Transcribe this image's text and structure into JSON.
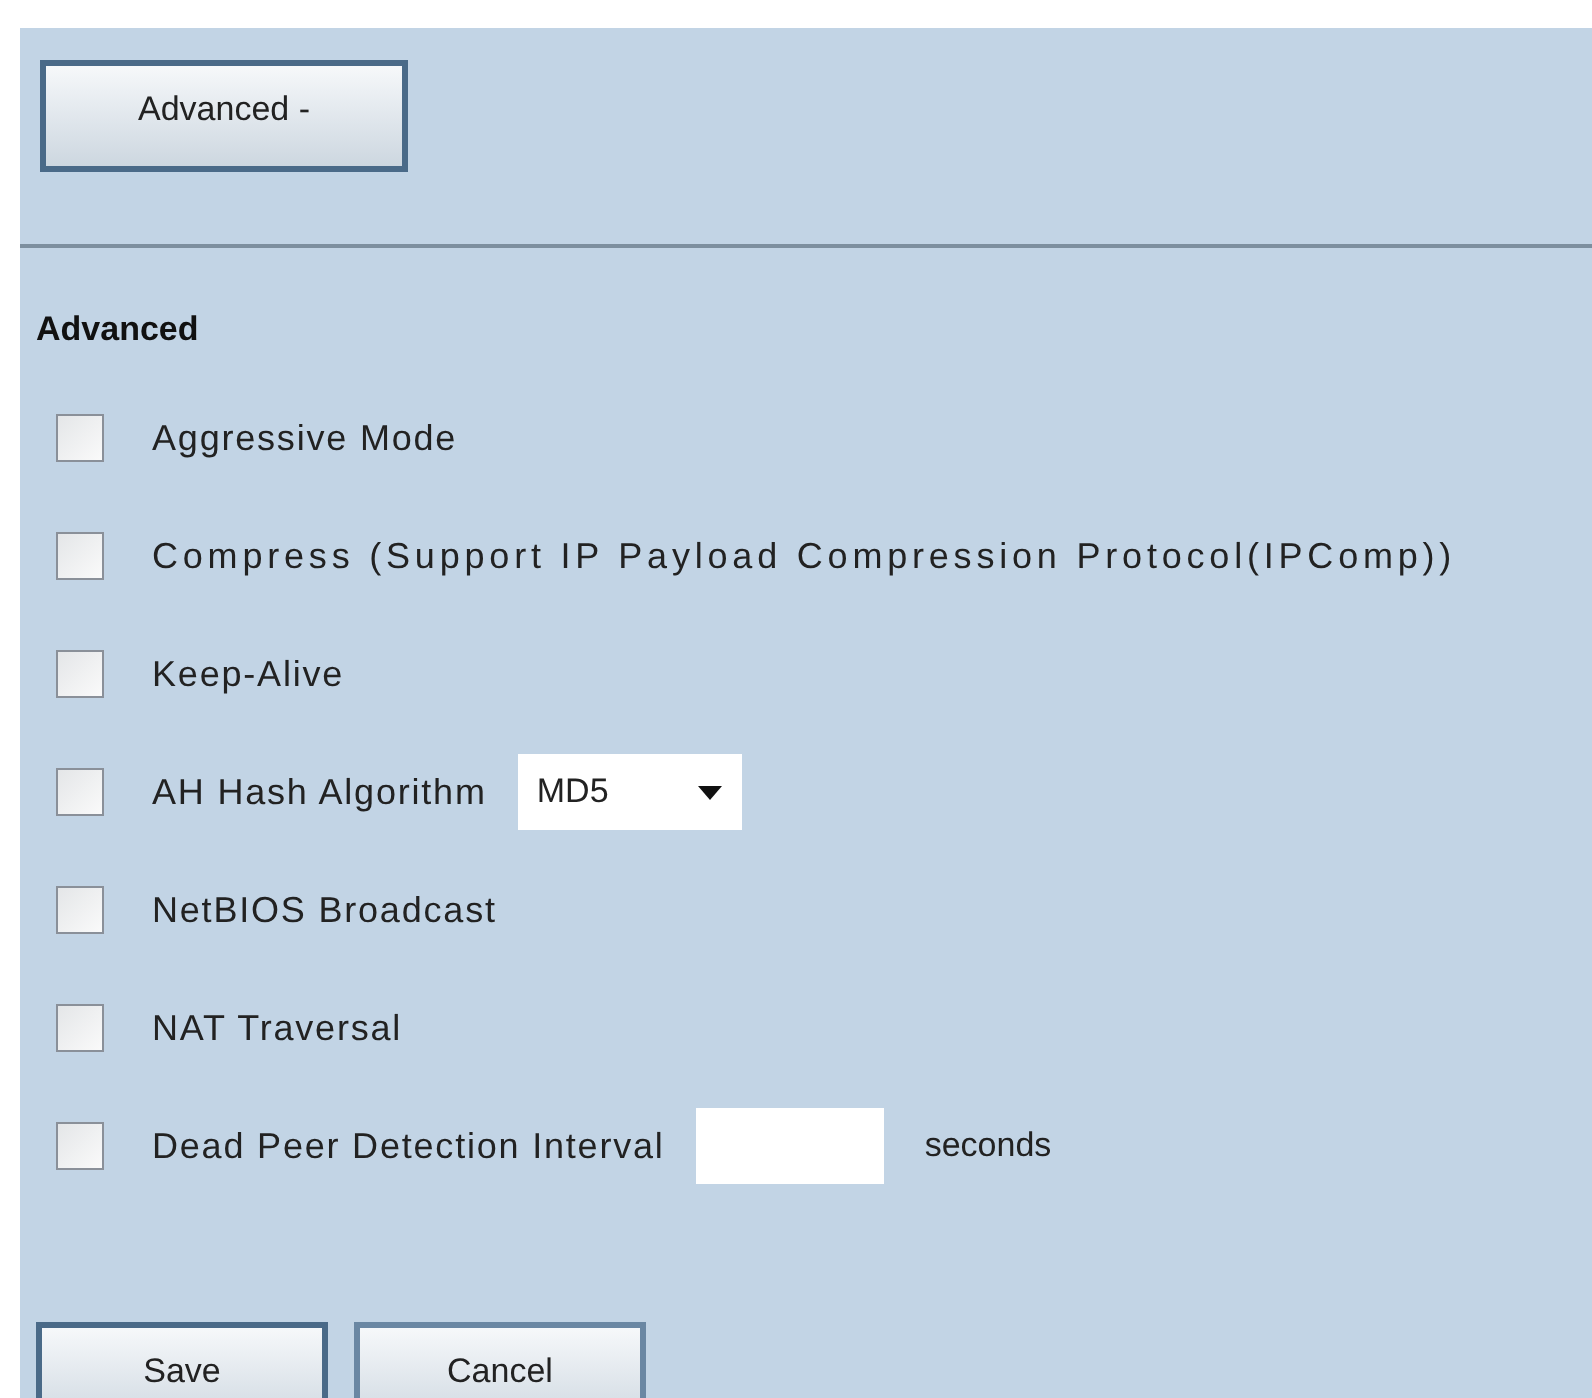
{
  "toggle_button": {
    "label": "Advanced -"
  },
  "section": {
    "title": "Advanced"
  },
  "options": [
    {
      "kind": "checkbox",
      "label": "Aggressive Mode",
      "checked": false
    },
    {
      "kind": "checkbox",
      "label": "Compress (Support IP Payload Compression Protocol(IPComp))",
      "checked": false
    },
    {
      "kind": "checkbox",
      "label": "Keep-Alive",
      "checked": false
    },
    {
      "kind": "select",
      "label": "AH Hash Algorithm",
      "checked": false,
      "value": "MD5"
    },
    {
      "kind": "checkbox",
      "label": "NetBIOS Broadcast",
      "checked": false
    },
    {
      "kind": "checkbox",
      "label": "NAT Traversal",
      "checked": false
    },
    {
      "kind": "input",
      "label": "Dead Peer Detection Interval",
      "checked": false,
      "suffix": "seconds"
    }
  ],
  "buttons": [
    {
      "label": "Save",
      "primary": true
    },
    {
      "label": "Cancel",
      "primary": false
    }
  ]
}
